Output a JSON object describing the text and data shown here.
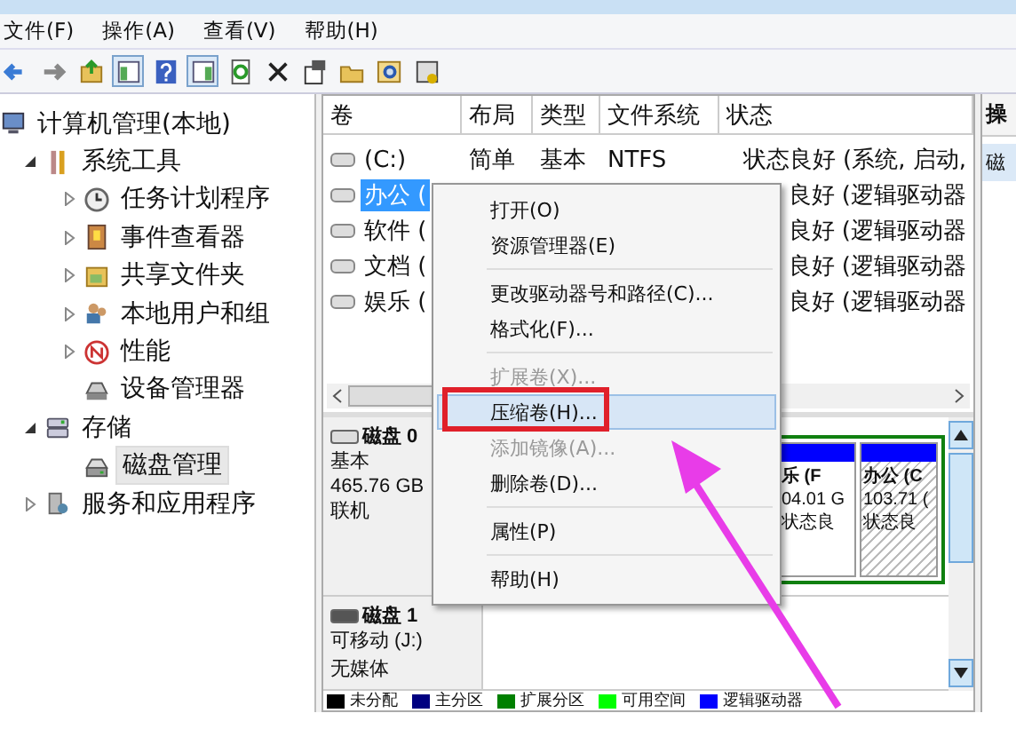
{
  "menu_bar": [
    "文件(F)",
    "操作(A)",
    "查看(V)",
    "帮助(H)"
  ],
  "toolbar": [
    {
      "kind": "back",
      "pressed": false
    },
    {
      "kind": "forward",
      "pressed": false
    },
    {
      "kind": "up",
      "pressed": false
    },
    {
      "kind": "tree",
      "pressed": true
    },
    {
      "kind": "help",
      "pressed": false
    },
    {
      "kind": "pane",
      "pressed": true
    },
    {
      "kind": "refresh",
      "pressed": false
    },
    {
      "kind": "delete",
      "pressed": false
    },
    {
      "kind": "properties",
      "pressed": false
    },
    {
      "kind": "open",
      "pressed": false
    },
    {
      "kind": "search",
      "pressed": false
    },
    {
      "kind": "settings",
      "pressed": false
    }
  ],
  "tree": [
    {
      "label": "计算机管理(本地)",
      "kind": "computer",
      "selected": false,
      "children": [
        {
          "label": "系统工具",
          "kind": "tools",
          "expanded": true,
          "selected": false,
          "children": [
            {
              "label": "任务计划程序",
              "kind": "clock",
              "expanded": false,
              "selected": false
            },
            {
              "label": "事件查看器",
              "kind": "log",
              "expanded": false,
              "selected": false
            },
            {
              "label": "共享文件夹",
              "kind": "share",
              "expanded": false,
              "selected": false
            },
            {
              "label": "本地用户和组",
              "kind": "users",
              "expanded": false,
              "selected": false
            },
            {
              "label": "性能",
              "kind": "perf",
              "expanded": false,
              "selected": false
            },
            {
              "label": "设备管理器",
              "kind": "device",
              "selected": false
            }
          ]
        },
        {
          "label": "存储",
          "kind": "storage",
          "expanded": true,
          "selected": false,
          "children": [
            {
              "label": "磁盘管理",
              "kind": "disk",
              "selected": true
            }
          ]
        },
        {
          "label": "服务和应用程序",
          "kind": "services",
          "expanded": false,
          "selected": false
        }
      ]
    }
  ],
  "volumes": {
    "columns": [
      "卷",
      "布局",
      "类型",
      "文件系统",
      "状态"
    ],
    "rows": [
      {
        "cells": [
          "(C:)",
          "简单",
          "基本",
          "NTFS",
          "状态良好 (系统, 启动,"
        ],
        "selected": false
      },
      {
        "cells": [
          "办公 (",
          "",
          "",
          "",
          "良好 (逻辑驱动器"
        ],
        "selected": true
      },
      {
        "cells": [
          "软件 (",
          "",
          "",
          "",
          "良好 (逻辑驱动器"
        ],
        "selected": false
      },
      {
        "cells": [
          "文档 (",
          "",
          "",
          "",
          "良好 (逻辑驱动器"
        ],
        "selected": false
      },
      {
        "cells": [
          "娱乐 (",
          "",
          "",
          "",
          "良好 (逻辑驱动器"
        ],
        "selected": false
      }
    ]
  },
  "disks": [
    {
      "name": "磁盘 0",
      "kind": "fixed",
      "lines": [
        "基本",
        "465.76 GB",
        "联机"
      ],
      "partitions": [
        {
          "label": "乐 (F",
          "size": "04.01 G",
          "status": "状态良",
          "selected": false
        },
        {
          "label": "办公 (C",
          "size": "103.71 (",
          "status": "状态良",
          "selected": true
        }
      ]
    },
    {
      "name": "磁盘 1",
      "kind": "removable",
      "lines": [
        "可移动 (J:)",
        "无媒体"
      ]
    }
  ],
  "legend": [
    {
      "label": "未分配",
      "color": "#000000"
    },
    {
      "label": "主分区",
      "color": "#000080"
    },
    {
      "label": "扩展分区",
      "color": "#008000"
    },
    {
      "label": "可用空间",
      "color": "#00ff00"
    },
    {
      "label": "逻辑驱动器",
      "color": "#0000ff"
    }
  ],
  "context_menu": [
    {
      "kind": "item",
      "label": "打开(O)",
      "disabled": false,
      "selected": false
    },
    {
      "kind": "item",
      "label": "资源管理器(E)",
      "disabled": false,
      "selected": false
    },
    {
      "kind": "separator"
    },
    {
      "kind": "item",
      "label": "更改驱动器号和路径(C)...",
      "disabled": false,
      "selected": false
    },
    {
      "kind": "item",
      "label": "格式化(F)...",
      "disabled": false,
      "selected": false
    },
    {
      "kind": "separator"
    },
    {
      "kind": "item",
      "label": "扩展卷(X)...",
      "disabled": true,
      "selected": false
    },
    {
      "kind": "item",
      "label": "压缩卷(H)...",
      "disabled": false,
      "selected": true
    },
    {
      "kind": "item",
      "label": "添加镜像(A)...",
      "disabled": true,
      "selected": false
    },
    {
      "kind": "item",
      "label": "删除卷(D)...",
      "disabled": false,
      "selected": false
    },
    {
      "kind": "separator"
    },
    {
      "kind": "item",
      "label": "属性(P)",
      "disabled": false,
      "selected": false
    },
    {
      "kind": "separator"
    },
    {
      "kind": "item",
      "label": "帮助(H)",
      "disabled": false,
      "selected": false
    }
  ],
  "actions": {
    "header": "操",
    "items": [
      {
        "label": "磁",
        "selected": true
      }
    ]
  }
}
